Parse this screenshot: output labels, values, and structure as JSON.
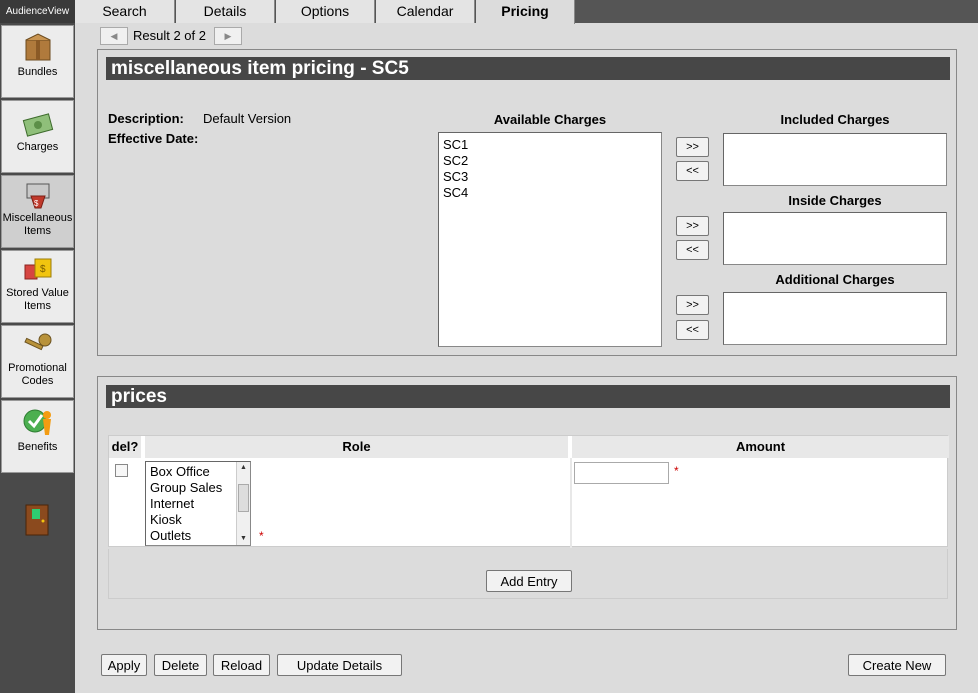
{
  "app": {
    "brand": "AudienceView"
  },
  "sidebar": {
    "items": [
      {
        "label_1": "Bundles",
        "label_2": "",
        "icon": "bundles-icon"
      },
      {
        "label_1": "Charges",
        "label_2": "",
        "icon": "charges-icon"
      },
      {
        "label_1": "Miscellaneous",
        "label_2": "Items",
        "icon": "misc-items-icon"
      },
      {
        "label_1": "Stored Value",
        "label_2": "Items",
        "icon": "stored-value-icon"
      },
      {
        "label_1": "Promotional",
        "label_2": "Codes",
        "icon": "promo-codes-icon"
      },
      {
        "label_1": "Benefits",
        "label_2": "",
        "icon": "benefits-icon"
      }
    ]
  },
  "tabs": [
    "Search",
    "Details",
    "Options",
    "Calendar",
    "Pricing"
  ],
  "pager": {
    "text": "Result 2 of 2"
  },
  "pricing_panel": {
    "title": "miscellaneous item pricing - SC5",
    "description_label": "Description:",
    "description_value": "Default Version",
    "effective_label": "Effective Date:",
    "available_label": "Available Charges",
    "available_options": [
      "SC1",
      "SC2",
      "SC3",
      "SC4"
    ],
    "included_label": "Included Charges",
    "inside_label": "Inside Charges",
    "additional_label": "Additional Charges",
    "add_label": ">>",
    "remove_label": "<<"
  },
  "prices_panel": {
    "title": "prices",
    "col_del": "del?",
    "col_role": "Role",
    "col_amount": "Amount",
    "role_options": [
      "Box Office",
      "Group Sales",
      "Internet",
      "Kiosk",
      "Outlets"
    ],
    "required_mark": "*",
    "amount_value": "",
    "add_entry_label": "Add Entry"
  },
  "actions": {
    "apply": "Apply",
    "delete": "Delete",
    "reload": "Reload",
    "update_details": "Update Details",
    "create_new": "Create New"
  }
}
